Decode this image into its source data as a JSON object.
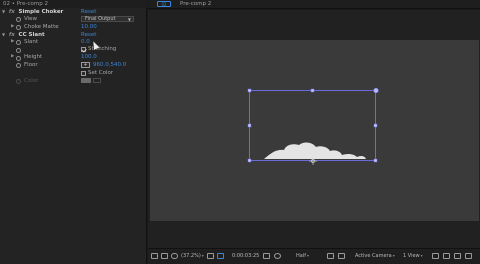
{
  "effect_controls": {
    "header": "02 • Pre-comp 2",
    "fx_glyph": "fx",
    "reset_label": "Reset",
    "simple_choker": {
      "name": "Simple Choker",
      "view_label": "View",
      "view_value": "Final Output",
      "choke_matte_label": "Choke Matte",
      "choke_matte_value": "10.00"
    },
    "cc_slant": {
      "name": "CC Slant",
      "slant_label": "Slant",
      "slant_value": "0.0",
      "stretching_label": "Stretching",
      "stretching_checked": true,
      "height_label": "Height",
      "height_value": "100.0",
      "floor_label": "Floor",
      "floor_value": "960.0,540.0",
      "set_color_label": "Set Color",
      "set_color_checked": false,
      "color_label": "Color"
    }
  },
  "composition": {
    "tab_label": "Pre-comp 2",
    "tab_box_label": "02"
  },
  "toolbar": {
    "zoom": "(37.2%)",
    "timecode": "0:00:03:25",
    "resolution": "Half",
    "camera": "Active Camera",
    "views": "1 View"
  },
  "colors": {
    "accent_blue": "#3c86d9",
    "selection_box": "#6a6adc",
    "shape_fill": "#e4e4e4"
  }
}
